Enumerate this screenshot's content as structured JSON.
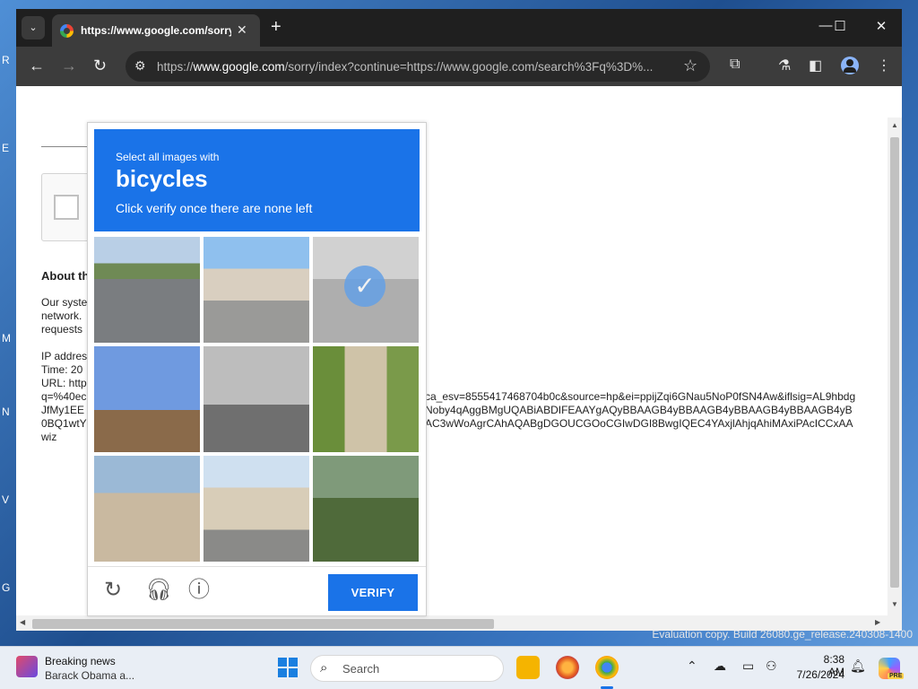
{
  "desktop": {
    "side_labels": [
      "R",
      "E",
      "M",
      "N",
      "V",
      "G"
    ],
    "watermark": "Evaluation copy. Build 26080.ge_release.240308-1400"
  },
  "browser": {
    "tab": {
      "title": "https://www.google.com/sorry",
      "close": "✕"
    },
    "tab_dropdown": "⌄",
    "new_tab": "+",
    "window_controls": {
      "minimize": "—",
      "maximize": "☐",
      "close": "✕"
    },
    "nav": {
      "back": "←",
      "forward": "→",
      "reload": "↻"
    },
    "address": {
      "prefix": "https://",
      "host": "www.google.com",
      "path": "/sorry/index?continue=https://www.google.com/search%3Fq%3D%..."
    }
  },
  "page": {
    "about_heading": "About th",
    "para1": [
      "Our syste",
      "network.",
      "requests"
    ],
    "ip_block": [
      "IP addres",
      "Time: 20",
      "URL: http",
      "q=%40ec",
      "JfMy1EE",
      "0BQ1wtY",
      "wiz"
    ],
    "url_tail": [
      "ca_esv=8555417468704b0c&source=hp&ei=ppijZqi6GNau5NoP0fSN4Aw&iflsig=AL9hbdg",
      "Noby4qAggBMgUQABiABDIFEAAYgAQyBBAAGB4yBBAAGB4yBBAAGB4yBBAAGB4yB",
      "AC3wWoAgrCAhAQABgDGOUCGOoCGIwDGI8BwgIQEC4YAxjlAhjqAhiMAxiPAcICCxAA"
    ]
  },
  "captcha": {
    "instruction_line1": "Select all images with",
    "target": "bicycles",
    "instruction_line2": "Click verify once there are none left",
    "tiles": [
      {
        "name": "street-road",
        "selected": false
      },
      {
        "name": "houses-street",
        "selected": false
      },
      {
        "name": "parked-bicycles",
        "selected": true
      },
      {
        "name": "power-lines",
        "selected": false
      },
      {
        "name": "bicycle-by-wall",
        "selected": false
      },
      {
        "name": "scooter-gate",
        "selected": false
      },
      {
        "name": "bicycles-rack",
        "selected": false
      },
      {
        "name": "residential-street",
        "selected": false
      },
      {
        "name": "garden-hedge",
        "selected": false
      }
    ],
    "verify_label": "VERIFY",
    "icons": {
      "reload": "reload-icon",
      "audio": "headphones-icon",
      "info": "info-icon"
    }
  },
  "taskbar": {
    "news_title": "Breaking news",
    "news_subtitle": "Barack Obama a...",
    "search_placeholder": "Search",
    "time": "8:38 AM",
    "date": "7/26/2024",
    "copilot_badge": "PRE"
  },
  "colors": {
    "captcha_blue": "#1a73e8",
    "browser_dark": "#1f1f1f",
    "toolbar": "#3c3c3c"
  }
}
